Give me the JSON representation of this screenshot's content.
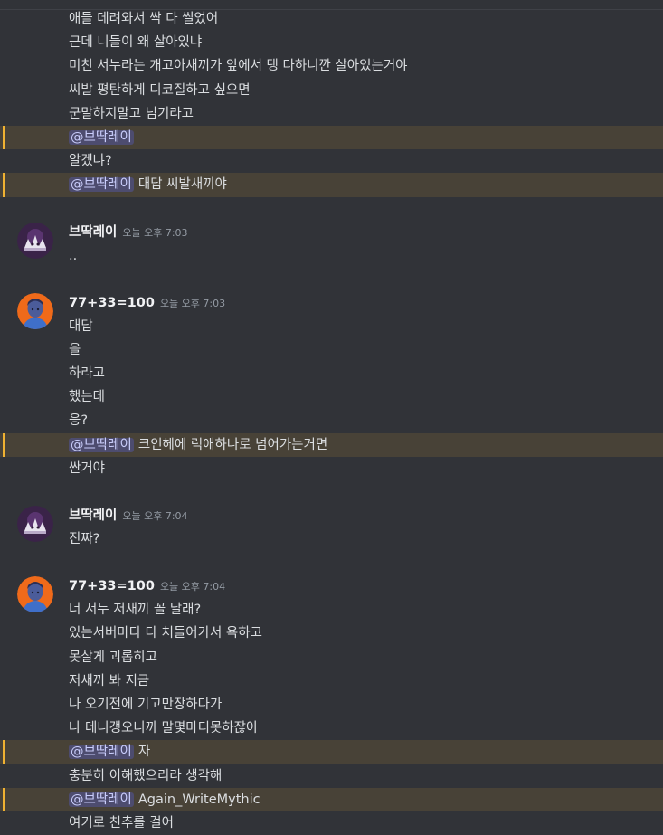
{
  "users": {
    "a": {
      "name": "브딱레이"
    },
    "b": {
      "name": "77+33=100"
    }
  },
  "messages": {
    "m1": "애들 데려와서 싹 다 썰었어",
    "m2": "근데 니들이 왜 살아있냐",
    "m3": "미친 서누라는 개고아새끼가 앞에서 탱 다하니깐 살아있는거야",
    "m4": "씨발 평탄하게 디코질하고 싶으면",
    "m5": "군말하지말고 넘기라고",
    "m6_mention": "@브딱레이",
    "m7": "알겠냐?",
    "m8_mention": "@브딱레이",
    "m8_text": "대답 씨발새끼야",
    "g2_time": "오늘 오후 7:03",
    "g2_m1": "..",
    "g3_time": "오늘 오후 7:03",
    "g3_m1": "대답",
    "g3_m2": "을",
    "g3_m3": "하라고",
    "g3_m4": "했는데",
    "g3_m5": "응?",
    "g3_m6_mention": "@브딱레이",
    "g3_m6_text": "크인헤에 럭애하나로 넘어가는거면",
    "g3_m7": "싼거야",
    "g4_time": "오늘 오후 7:04",
    "g4_m1": "진짜?",
    "g5_time": "오늘 오후 7:04",
    "g5_m1": "너 서누 저새끼 꼴 날래?",
    "g5_m2": "있는서버마다 다 처들어가서 욕하고",
    "g5_m3": "못살게 괴롭히고",
    "g5_m4": "저새끼 봐 지금",
    "g5_m5": "나 오기전에 기고만장하다가",
    "g5_m6": "나 데니갱오니까 말몇마디못하잖아",
    "g5_m7_mention": "@브딱레이",
    "g5_m7_text": "자",
    "g5_m8": "충분히 이해했으리라 생각해",
    "g5_m9_mention": "@브딱레이",
    "g5_m9_text": "Again_WriteMythic",
    "g5_m10": "여기로 친추를 걸어"
  }
}
